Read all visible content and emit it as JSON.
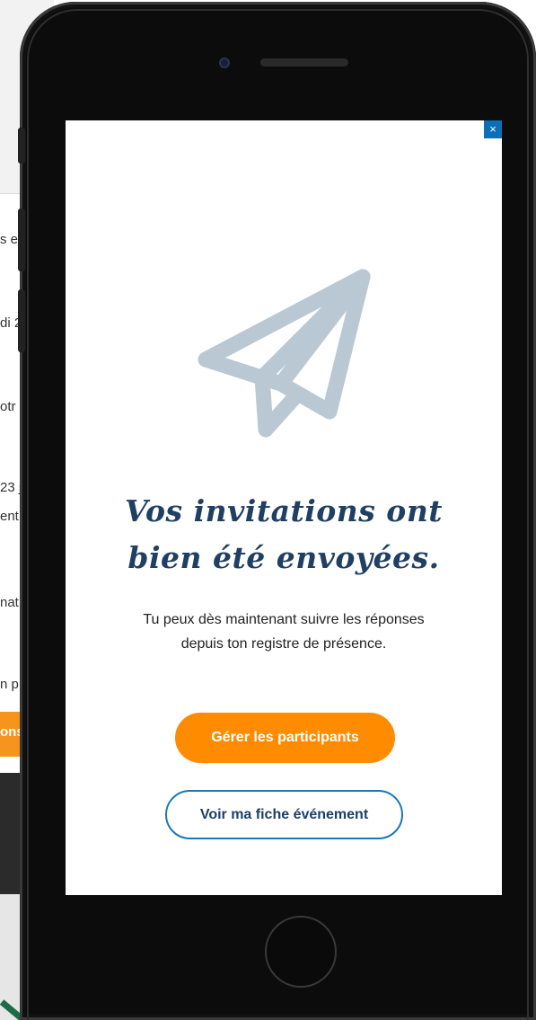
{
  "background_app": {
    "lines": [
      "s e",
      "di 2",
      "otr",
      "23 j",
      "ent",
      "nat",
      "n p"
    ],
    "button_label": "ons"
  },
  "modal": {
    "close_label": "×",
    "headline_line1": "Vos invitations ont",
    "headline_line2": "bien été envoyées.",
    "subtext_line1": "Tu peux dès maintenant suivre les réponses",
    "subtext_line2": "depuis ton registre de présence.",
    "primary_button": "Gérer les participants",
    "secondary_button": "Voir ma fiche événement",
    "icon": "paper-plane-icon"
  },
  "colors": {
    "accent_orange": "#ff8c00",
    "headline_navy": "#1f3f63",
    "outline_blue": "#1b76b9",
    "close_blue": "#0b6fb5",
    "plane_gray": "#b9c8d3"
  }
}
